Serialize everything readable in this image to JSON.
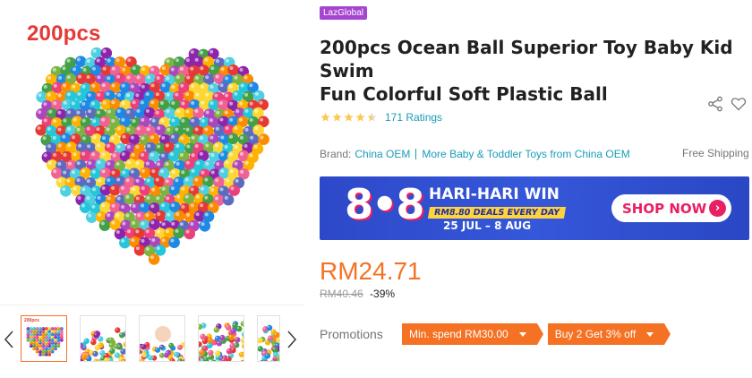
{
  "gallery": {
    "overlay_label": "200pcs",
    "thumbnails": [
      {
        "label": "200pcs",
        "active": true
      },
      {
        "label": "",
        "active": false
      },
      {
        "label": "",
        "active": false
      },
      {
        "label": "",
        "active": false
      },
      {
        "label": "",
        "active": false
      }
    ],
    "prev_icon": "chevron-left-icon",
    "next_icon": "chevron-right-icon"
  },
  "product": {
    "badge": "LazGlobal",
    "title_line1": "200pcs Ocean Ball Superior Toy Baby Kid Swim",
    "title_line2": "Fun Colorful Soft Plastic Ball",
    "share_icon": "share-icon",
    "wishlist_icon": "heart-outline-icon",
    "rating": {
      "stars": 4.5,
      "count_text": "171 Ratings"
    },
    "brand": {
      "label": "Brand:",
      "name": "China OEM",
      "more_text": "More Baby & Toddler Toys from China OEM"
    },
    "shipping_text": "Free Shipping",
    "banner": {
      "big_text": "8•8",
      "headline": "HARI-HARI WIN",
      "deal_text": "RM8.80 DEALS EVERY DAY",
      "dates": "25 JUL – 8 AUG",
      "cta": "SHOP NOW"
    },
    "price": "RM24.71",
    "original_price": "RM40.46",
    "discount": "-39%",
    "promotions": {
      "label": "Promotions",
      "vouchers": [
        "Min. spend RM30.00",
        "Buy 2 Get 3% off"
      ]
    }
  },
  "colors": {
    "accent_orange": "#f57224",
    "link_blue": "#1a9cb7",
    "badge_purple": "#a646d0",
    "banner_blue": "#3557d9",
    "label_red": "#e53935"
  }
}
